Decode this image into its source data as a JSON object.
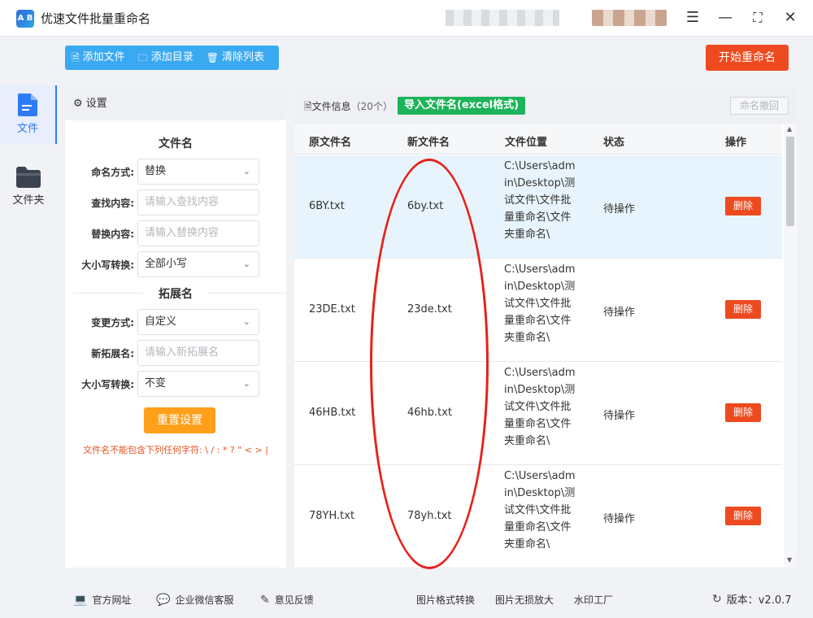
{
  "app": {
    "title": "优速文件批量重命名",
    "logo_text": "A B"
  },
  "window": {
    "menu_icon": "menu-icon",
    "minimize_icon": "minimize-icon",
    "maximize_icon": "fullscreen-icon",
    "close_icon": "close-icon"
  },
  "sidenav": {
    "items": [
      {
        "label": "文件",
        "icon": "file-icon",
        "active": true
      },
      {
        "label": "文件夹",
        "icon": "folder-icon",
        "active": false
      }
    ]
  },
  "toolbar": {
    "add_file": "添加文件",
    "add_dir": "添加目录",
    "clear_list": "清除列表",
    "start": "开始重命名"
  },
  "settings": {
    "header": "设置",
    "filename_section": "文件名",
    "naming_mode_label": "命名方式:",
    "naming_mode_value": "替换",
    "find_label": "查找内容:",
    "find_placeholder": "请输入查找内容",
    "replace_label": "替换内容:",
    "replace_placeholder": "请输入替换内容",
    "case_label": "大小写转换:",
    "case_value": "全部小写",
    "ext_section": "拓展名",
    "change_mode_label": "变更方式:",
    "change_mode_value": "自定义",
    "new_ext_label": "新拓展名:",
    "new_ext_placeholder": "请输入新拓展名",
    "ext_case_label": "大小写转换:",
    "ext_case_value": "不变",
    "reset": "重置设置",
    "warning": "文件名不能包含下列任何字符: \\ / : * ? \" < > |"
  },
  "filelist": {
    "info_label": "文件信息",
    "count": "（20个）",
    "import_btn": "导入文件名(excel格式)",
    "undo_btn": "命名撤回",
    "columns": [
      "原文件名",
      "新文件名",
      "文件位置",
      "状态",
      "操作"
    ],
    "delete_label": "删除",
    "rows": [
      {
        "orig": "6BY.txt",
        "new": "6by.txt",
        "path": "C:\\Users\\admin\\Desktop\\测试文件\\文件批量重命名\\文件夹重命名\\",
        "status": "待操作"
      },
      {
        "orig": "23DE.txt",
        "new": "23de.txt",
        "path": "C:\\Users\\admin\\Desktop\\测试文件\\文件批量重命名\\文件夹重命名\\",
        "status": "待操作"
      },
      {
        "orig": "46HB.txt",
        "new": "46hb.txt",
        "path": "C:\\Users\\admin\\Desktop\\测试文件\\文件批量重命名\\文件夹重命名\\",
        "status": "待操作"
      },
      {
        "orig": "78YH.txt",
        "new": "78yh.txt",
        "path": "C:\\Users\\admin\\Desktop\\测试文件\\文件批量重命名\\文件夹重命名\\",
        "status": "待操作"
      }
    ]
  },
  "footer": {
    "website": "官方网址",
    "wechat": "企业微信客服",
    "feedback": "意见反馈",
    "img_convert": "图片格式转换",
    "img_enlarge": "图片无损放大",
    "watermark": "水印工厂",
    "version": "版本：v2.0.7"
  },
  "colors": {
    "accent": "#39a9f2",
    "start": "#ee4a1f",
    "reset": "#ff9f1a",
    "import": "#1eb35a",
    "annotation": "#e8201a"
  }
}
